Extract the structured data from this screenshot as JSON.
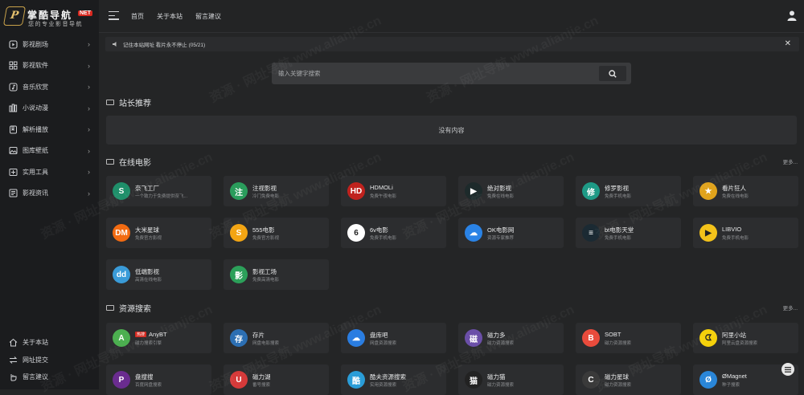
{
  "brand": {
    "mark": "P",
    "name": "掌酷导航",
    "badge": "NET",
    "slogan": "您的专业影音导航"
  },
  "sidebar": {
    "items": [
      {
        "label": "影视剧场",
        "icon": "play-square-icon"
      },
      {
        "label": "影视软件",
        "icon": "grid-icon"
      },
      {
        "label": "音乐欣赏",
        "icon": "music-icon"
      },
      {
        "label": "小说动漫",
        "icon": "books-icon"
      },
      {
        "label": "解析播放",
        "icon": "bookmark-icon"
      },
      {
        "label": "图库壁纸",
        "icon": "image-icon"
      },
      {
        "label": "实用工具",
        "icon": "tool-icon"
      },
      {
        "label": "影视资讯",
        "icon": "news-icon"
      }
    ],
    "bottom": [
      {
        "label": "关于本站",
        "icon": "home-icon"
      },
      {
        "label": "网址提交",
        "icon": "swap-icon"
      },
      {
        "label": "留言建议",
        "icon": "hand-icon"
      }
    ]
  },
  "topnav": {
    "items": [
      "首页",
      "关于本站",
      "留言建议"
    ]
  },
  "notice": {
    "text": "记住本站网址 看片永不停止 (05/21)"
  },
  "search": {
    "placeholder": "输入关键字搜索"
  },
  "sections": {
    "recommend": {
      "title": "站长推荐",
      "empty": "没有内容"
    },
    "movies": {
      "title": "在线电影",
      "more": "更多...",
      "cards": [
        {
          "name": "奈飞工厂",
          "desc": "一个致力于免费提供奈飞...",
          "icon": "S",
          "color": "#1f8f6a"
        },
        {
          "name": "注视影视",
          "desc": "冷门免费电影",
          "icon": "注",
          "color": "#2a9d5c"
        },
        {
          "name": "HDMOLi",
          "desc": "免费午夜电影",
          "icon": "HD",
          "color": "#c0221e"
        },
        {
          "name": "绝对影视",
          "desc": "免费在线电影",
          "icon": "▶",
          "color": "#1d2a2b"
        },
        {
          "name": "修罗影视",
          "desc": "免费手机电影",
          "icon": "修",
          "color": "#1e9a86"
        },
        {
          "name": "看片狂人",
          "desc": "免费在线电影",
          "icon": "★",
          "color": "#e0a31c"
        },
        {
          "name": "大米星球",
          "desc": "免费官方影视",
          "icon": "DM",
          "color": "#f26b12"
        },
        {
          "name": "555电影",
          "desc": "免费官方影视",
          "icon": "S",
          "color": "#f3a513"
        },
        {
          "name": "6v电影",
          "desc": "免费手机电影",
          "icon": "6",
          "color": "#ffffff"
        },
        {
          "name": "OK电影网",
          "desc": "资源专家推荐",
          "icon": "☁",
          "color": "#2a83e6"
        },
        {
          "name": "bt电影天堂",
          "desc": "免费手机电影",
          "icon": "≡",
          "color": "#1b2a33"
        },
        {
          "name": "LIBVIO",
          "desc": "免费手机电影",
          "icon": "▶",
          "color": "#f3c21a"
        },
        {
          "name": "低端影视",
          "desc": "高清在线电影",
          "icon": "dd",
          "color": "#3a9bd8"
        },
        {
          "name": "影视工场",
          "desc": "免费高清电影",
          "icon": "影",
          "color": "#2ca05a"
        }
      ]
    },
    "resources": {
      "title": "资源搜索",
      "more": "更多...",
      "cards": [
        {
          "name": "AnyBT",
          "badge": "热搜",
          "desc": "磁力搜索引擎",
          "icon": "A",
          "color": "#4caf50"
        },
        {
          "name": "存片",
          "desc": "网盘电影搜索",
          "icon": "存",
          "color": "#2c6fb3"
        },
        {
          "name": "盘库吧",
          "desc": "网盘资源搜索",
          "icon": "☁",
          "color": "#2a7de1"
        },
        {
          "name": "磁力多",
          "desc": "磁力资源搜索",
          "icon": "磁",
          "color": "#6b4fa8"
        },
        {
          "name": "SOBT",
          "desc": "磁力资源搜索",
          "icon": "B",
          "color": "#e94b3c"
        },
        {
          "name": "阿里小站",
          "desc": "阿里云盘资源搜索",
          "icon": "ᗧ",
          "color": "#f5d10a"
        },
        {
          "name": "盘搜搜",
          "desc": "百度网盘搜索",
          "icon": "P",
          "color": "#6a2c8f"
        },
        {
          "name": "磁力湖",
          "desc": "番号搜索",
          "icon": "U",
          "color": "#d63a3a"
        },
        {
          "name": "酷夫资源搜索",
          "desc": "实用资源搜索",
          "icon": "酷",
          "color": "#2a9dd8"
        },
        {
          "name": "磁力猫",
          "desc": "磁力资源搜索",
          "icon": "猫",
          "color": "#222222"
        },
        {
          "name": "磁力星球",
          "desc": "磁力资源搜索",
          "icon": "C",
          "color": "#3a3a3a"
        },
        {
          "name": "ØMagnet",
          "desc": "种子搜索",
          "icon": "Ø",
          "color": "#2a86d8"
        }
      ]
    }
  },
  "watermark": "资源 · 网址导航 www.alianjie.cn"
}
